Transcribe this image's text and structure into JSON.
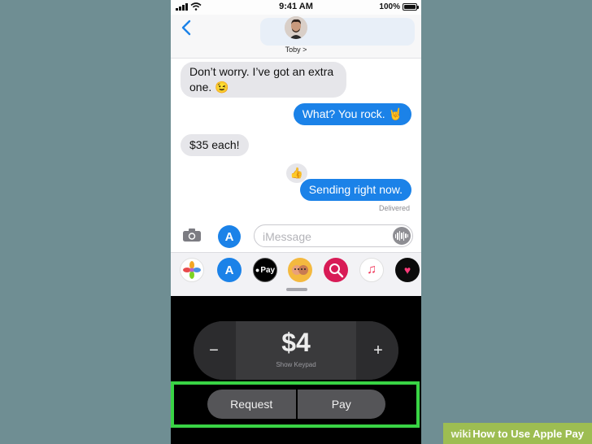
{
  "status_bar": {
    "time": "9:41 AM",
    "battery": "100%"
  },
  "header": {
    "contact_name": "Toby >"
  },
  "messages": [
    {
      "side": "left",
      "line1": "Don’t worry. I’ve got an extra",
      "line2": "one. 😉"
    },
    {
      "side": "right",
      "text": "What? You rock. 🤘"
    },
    {
      "side": "left",
      "text": "$35 each!"
    },
    {
      "side": "right",
      "text": "Sending right now.",
      "reaction": "👍"
    }
  ],
  "delivered": "Delivered",
  "input": {
    "placeholder": "iMessage"
  },
  "apps": [
    {
      "name": "Photos",
      "label": "",
      "color": "#ffffff"
    },
    {
      "name": "App Store",
      "label": "A",
      "color": "#1b82e8"
    },
    {
      "name": "Apple Pay",
      "label": "Pay",
      "color": "#000000"
    },
    {
      "name": "Memoji",
      "label": "",
      "color": "#f4b93f"
    },
    {
      "name": "Image Search",
      "label": "",
      "color": "#d81b56"
    },
    {
      "name": "Music",
      "label": "♫",
      "color": "#ffffff"
    },
    {
      "name": "Digital Touch",
      "label": "♥",
      "color": "#0b0b0b"
    }
  ],
  "pay": {
    "amount": "$4",
    "keypad_hint": "Show Keypad",
    "minus": "−",
    "plus": "+",
    "request_label": "Request",
    "pay_label": "Pay"
  },
  "watermark": {
    "wiki": "wiki",
    "text": "How to Use Apple Pay"
  },
  "colors": {
    "bubble_blue": "#1b82e8",
    "highlight_green": "#39d445",
    "page_bg": "#6f8e93"
  }
}
